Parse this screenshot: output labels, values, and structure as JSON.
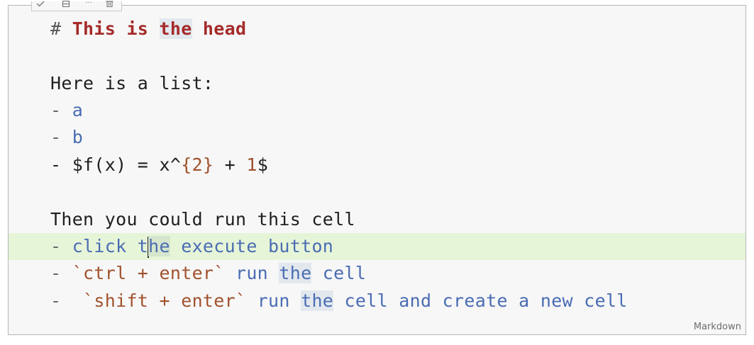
{
  "cell": {
    "language": "Markdown",
    "toolbar": {
      "buttons": [
        {
          "name": "check-icon"
        },
        {
          "name": "split-icon"
        },
        {
          "name": "more-icon",
          "glyph": "···"
        },
        {
          "name": "trash-icon"
        }
      ]
    },
    "lines": {
      "l1": {
        "hash": "# ",
        "h1": "This is ",
        "h2": "the",
        "h3": " head"
      },
      "l3": {
        "text": "Here is a list:"
      },
      "l4": {
        "dash": "- ",
        "text": "a"
      },
      "l5": {
        "dash": "- ",
        "text": "b"
      },
      "l6": {
        "a": "- $f(x) = x^",
        "b": "{2}",
        "c": " + ",
        "d": "1",
        "e": "$"
      },
      "l8": {
        "text": "Then you could run this cell"
      },
      "l9": {
        "dash": "- ",
        "a": "click t",
        "b": "he",
        "c": " execute button"
      },
      "l10": {
        "dash": "- ",
        "code": "`ctrl + enter`",
        "a": " run ",
        "b": "the",
        "c": " cell"
      },
      "l11": {
        "dash": "-  ",
        "code": "`shift + enter`",
        "a": " run ",
        "b": "the",
        "c": " cell and create a new cell"
      }
    }
  }
}
